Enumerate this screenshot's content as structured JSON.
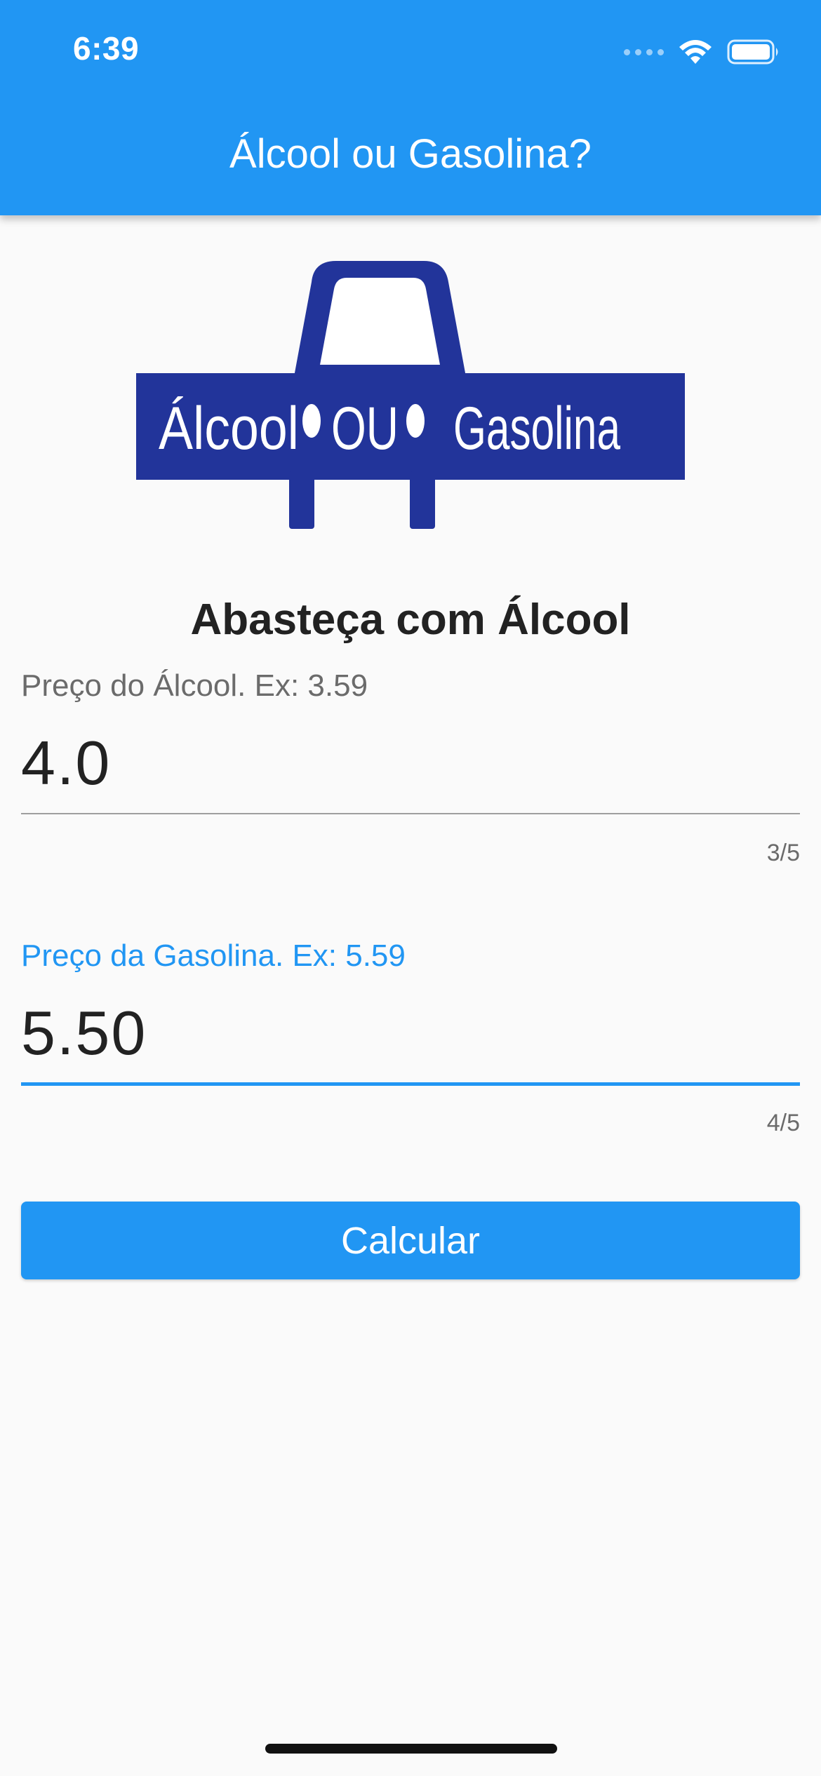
{
  "status_bar": {
    "time": "6:39",
    "icons": [
      "cellular-signal-icon",
      "wifi-icon",
      "battery-icon"
    ]
  },
  "app_bar": {
    "title": "Álcool ou Gasolina?",
    "color": "#2196f3"
  },
  "logo": {
    "left_text": "Álcool",
    "middle_text": "OU",
    "right_text": "Gasolina",
    "color": "#22349a"
  },
  "result": {
    "heading": "Abasteça com Álcool"
  },
  "form": {
    "alcool": {
      "label": "Preço do Álcool. Ex: 3.59",
      "value": "4.0",
      "counter": "3/5"
    },
    "gasolina": {
      "label": "Preço da Gasolina. Ex: 5.59",
      "value": "5.50",
      "counter": "4/5",
      "focused": true
    },
    "submit_label": "Calcular"
  }
}
